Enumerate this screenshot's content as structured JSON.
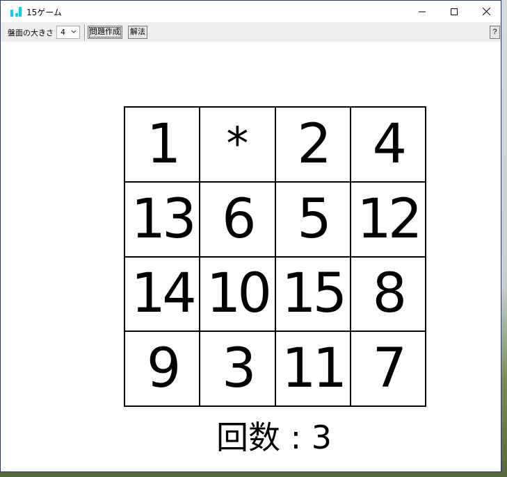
{
  "window": {
    "title": "15ゲーム",
    "icon": "bar-chart-icon",
    "accent_color": "#00d5ea"
  },
  "toolbar": {
    "size_label": "盤面の大きさ",
    "size_value": "4",
    "create_label": "問題作成",
    "solve_label": "解法",
    "help_label": "?"
  },
  "board": {
    "size": 4,
    "tiles": [
      "1",
      "*",
      "2",
      "4",
      "13",
      "6",
      "5",
      "12",
      "14",
      "10",
      "15",
      "8",
      "9",
      "3",
      "11",
      "7"
    ]
  },
  "counter": {
    "text": "回数 : 3"
  }
}
